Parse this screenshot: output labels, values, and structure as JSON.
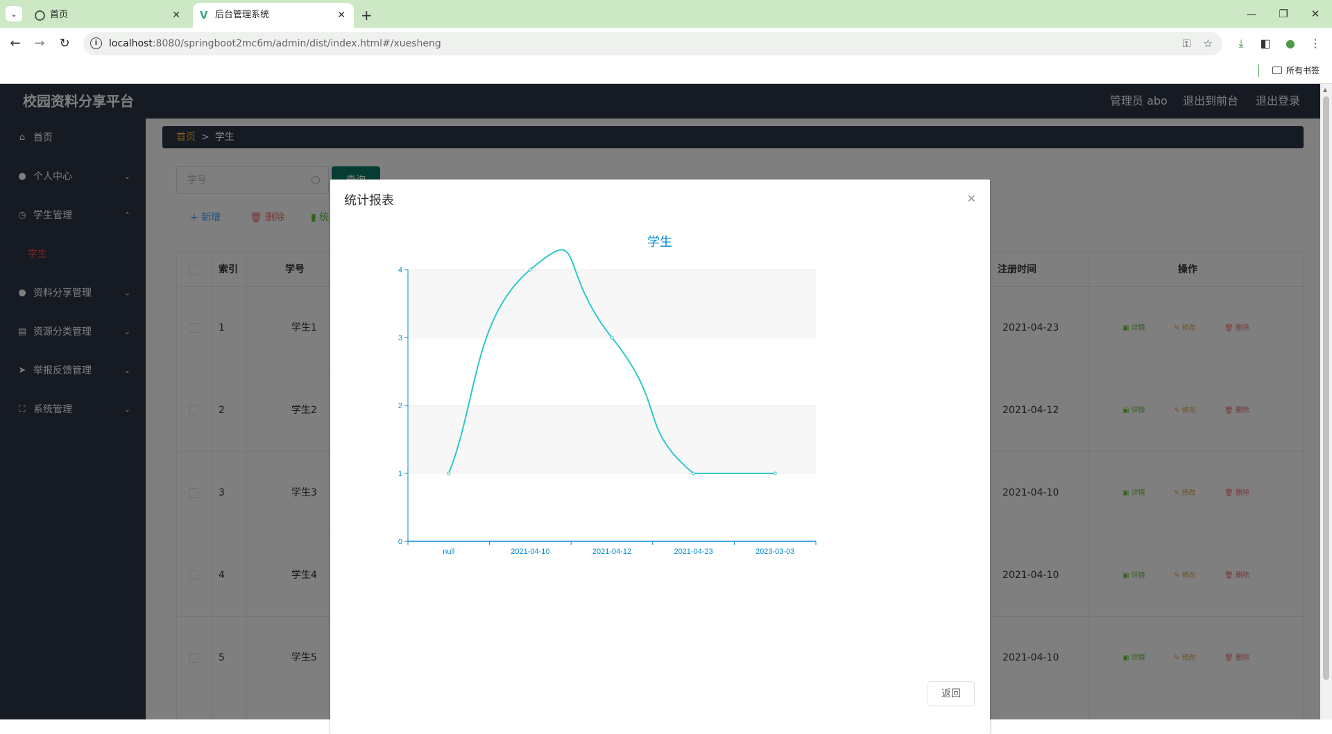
{
  "browser": {
    "tabs": [
      {
        "title": "首页"
      },
      {
        "title": "后台管理系统"
      }
    ],
    "url_host": "localhost",
    "url_rest": ":8080/springboot2mc6m/admin/dist/index.html#/xuesheng",
    "bookmarks_label": "所有书签"
  },
  "app": {
    "brand": "校园资料分享平台",
    "top_links": {
      "admin": "管理员 abo",
      "to_front": "退出到前台",
      "logout": "退出登录"
    },
    "menu": [
      {
        "label": "首页",
        "icon": "home-icon"
      },
      {
        "label": "个人中心",
        "icon": "user-icon"
      },
      {
        "label": "学生管理",
        "icon": "clock-icon"
      },
      {
        "label": "资料分享管理",
        "icon": "user-icon"
      },
      {
        "label": "资源分类管理",
        "icon": "clipboard-icon"
      },
      {
        "label": "举报反馈管理",
        "icon": "send-icon"
      },
      {
        "label": "系统管理",
        "icon": "fullscreen-icon"
      }
    ],
    "submenu_active": "学生",
    "breadcrumb": {
      "home": "首页",
      "sep": ">",
      "current": "学生"
    },
    "search": {
      "placeholder": "学号",
      "button": "查询"
    },
    "actions": {
      "add": "+ 新增",
      "delete": "删除",
      "stats": "统"
    },
    "table": {
      "headers": {
        "index": "索引",
        "xuehao": "学号",
        "regtime": "注册时间",
        "ops": "操作"
      },
      "rows": [
        {
          "index": "1",
          "xuehao": "学生1",
          "regtime": "2021-04-23"
        },
        {
          "index": "2",
          "xuehao": "学生2",
          "regtime": "2021-04-12"
        },
        {
          "index": "3",
          "xuehao": "学生3",
          "regtime": "2021-04-10"
        },
        {
          "index": "4",
          "xuehao": "学生4",
          "regtime": "2021-04-10"
        },
        {
          "index": "5",
          "xuehao": "学生5",
          "regtime": "2021-04-10"
        }
      ],
      "op_labels": {
        "detail": "详情",
        "edit": "修改",
        "delete": "删除"
      }
    }
  },
  "dialog": {
    "title": "统计报表",
    "back": "返回"
  },
  "chart_data": {
    "type": "line",
    "title": "学生",
    "categories": [
      "null",
      "2021-04-10",
      "2021-04-12",
      "2021-04-23",
      "2023-03-03"
    ],
    "values": [
      1,
      4,
      3,
      1,
      1
    ],
    "ylim": [
      0,
      4
    ],
    "yticks": [
      "0",
      "1",
      "2",
      "3",
      "4"
    ],
    "smooth": true,
    "grid": true,
    "color": "#2ec7c9",
    "axis_color": "#008acd"
  }
}
